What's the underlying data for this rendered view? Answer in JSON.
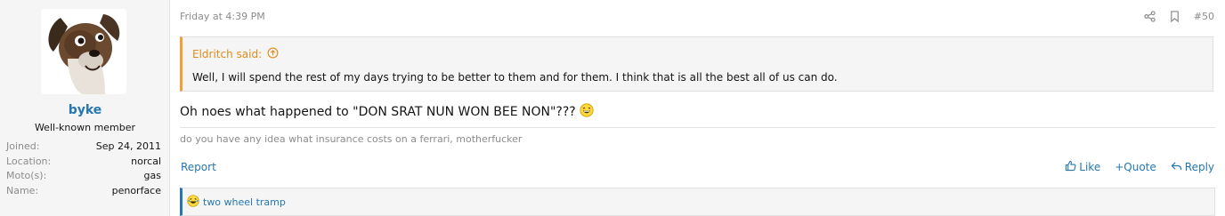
{
  "user": {
    "username": "byke",
    "user_title": "Well-known member",
    "extras": [
      {
        "label": "Joined:",
        "value": "Sep 24, 2011"
      },
      {
        "label": "Location:",
        "value": "norcal"
      },
      {
        "label": "Moto(s):",
        "value": "gas"
      },
      {
        "label": "Name:",
        "value": "penorface"
      }
    ]
  },
  "post": {
    "date": "Friday at 4:39 PM",
    "number": "#50",
    "quote": {
      "author": "Eldritch said:",
      "text": "Well, I will spend the rest of my days trying to be better to them and for them. I think that is all the best all of us can do."
    },
    "message": "Oh noes what happened to \"DON SRAT NUN WON BEE NON\"???",
    "signature": "do you have any idea what insurance costs on a ferrari, motherfucker",
    "report_label": "Report",
    "actions": {
      "like": "Like",
      "quote": "+Quote",
      "reply": "Reply"
    },
    "reactions": {
      "names": "two wheel tramp"
    }
  },
  "colors": {
    "link": "#2577b1",
    "quote_accent": "#f29f38",
    "muted": "#8c8c8c"
  },
  "icons": [
    "share-icon",
    "bookmark-icon",
    "arrow-up-circle-icon",
    "laughing-emoji-icon",
    "thumbs-up-icon",
    "reply-icon",
    "laugh-reaction-icon"
  ]
}
